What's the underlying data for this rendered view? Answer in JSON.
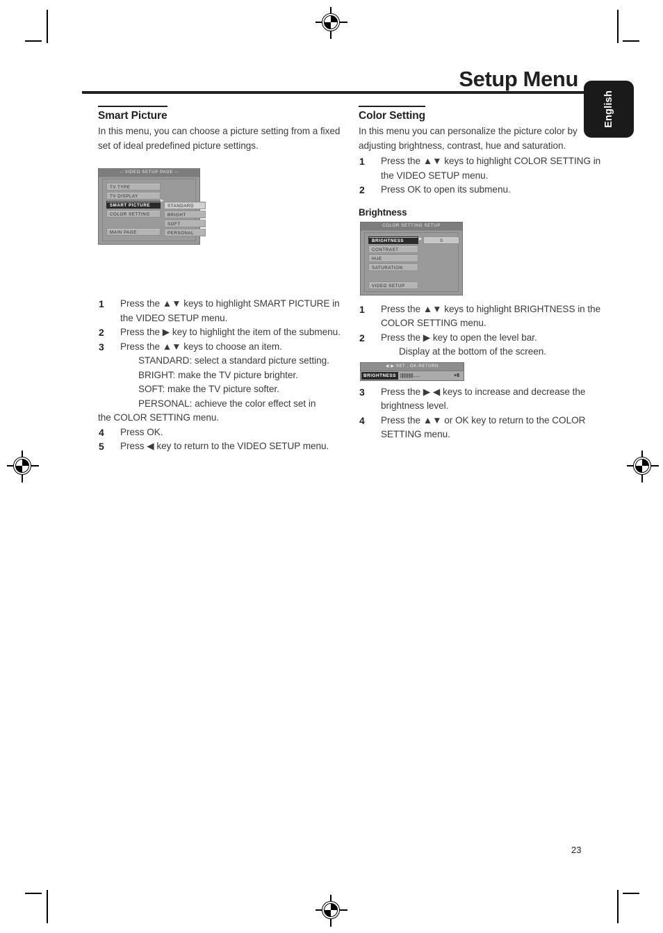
{
  "header": {
    "title": "Setup Menu",
    "language_tab": "English"
  },
  "page_number": "23",
  "left_column": {
    "section_title": "Smart Picture",
    "intro": "In this menu, you can choose a picture setting from a fixed set of ideal predefined picture settings.",
    "osd_video_setup": {
      "title": "-- VIDEO SETUP PAGE --",
      "menu_items": [
        "TV TYPE",
        "TV DISPLAY",
        "SMART PICTURE",
        "COLOR SETTING",
        "MAIN PAGE"
      ],
      "selected_item": "SMART PICTURE",
      "submenu_items": [
        "STANDARD",
        "BRIGHT",
        "SOFT",
        "PERSONAL"
      ],
      "submenu_highlighted": "STANDARD",
      "arrow_glyph": "➤"
    },
    "steps": [
      {
        "num": "1",
        "text": "Press the ▲▼ keys to highlight SMART PICTURE in the VIDEO SETUP menu."
      },
      {
        "num": "2",
        "text": "Press the ▶ key to highlight the item of the submenu."
      },
      {
        "num": "3",
        "text": "Press the ▲▼ keys to choose an item."
      }
    ],
    "step3_details": [
      "STANDARD: select a standard picture setting.",
      "BRIGHT: make the TV picture brighter.",
      "SOFT: make the TV picture softer.",
      "PERSONAL: achieve the color effect set in"
    ],
    "step3_trailing": "the COLOR  SETTING menu.",
    "steps_tail": [
      {
        "num": "4",
        "text": "Press OK."
      },
      {
        "num": "5",
        "text": "Press ◀ key to return to the VIDEO SETUP menu."
      }
    ]
  },
  "right_column": {
    "section_title": "Color Setting",
    "intro": "In this menu you can personalize the picture color by adjusting brightness, contrast, hue and saturation.",
    "steps": [
      {
        "num": "1",
        "text": "Press the ▲▼ keys to highlight COLOR SETTING in the VIDEO SETUP menu."
      },
      {
        "num": "2",
        "text": "Press OK to open its submenu."
      }
    ],
    "sub_section_title": "Brightness",
    "osd_color_setting": {
      "title": "COLOR SETTING SETUP",
      "menu_items": [
        "BRIGHTNESS",
        "CONTRAST",
        "HUE",
        "SATURATION",
        "VIDEO SETUP"
      ],
      "selected_item": "BRIGHTNESS",
      "value": "0",
      "arrow_glyph": "➤"
    },
    "steps2": [
      {
        "num": "1",
        "text": "Press the ▲▼ keys to highlight BRIGHTNESS in the COLOR SETTING menu."
      },
      {
        "num": "2",
        "text": "Press the ▶ key to open the level bar."
      }
    ],
    "step2_detail": "Display at the bottom of the screen.",
    "level_bar": {
      "hint": "◀ ▶ SET ,  OK-RETURN",
      "label": "BRIGHTNESS",
      "ticks": "|||||||||||||......",
      "value": "+8"
    },
    "steps3": [
      {
        "num": "3",
        "text": "Press the ▶ ◀ keys to increase and decrease the brightness level."
      },
      {
        "num": "4",
        "text": "Press the ▲▼ or OK key to return to the COLOR SETTING menu."
      }
    ]
  }
}
